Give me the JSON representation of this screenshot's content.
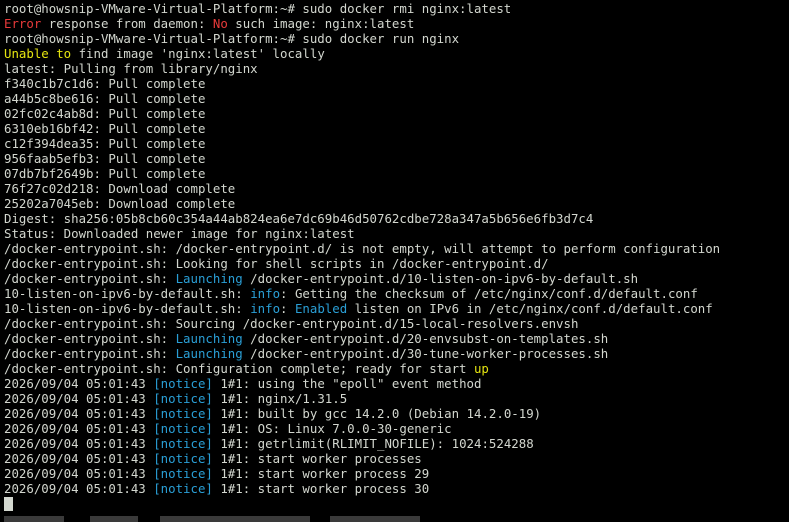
{
  "colors": {
    "background": "#000000",
    "foreground": "#d3d7cf",
    "red": "#e83a3a",
    "yellow": "#e5e510",
    "cyan": "#2a9fd6",
    "green": "#4ec94e"
  },
  "lines": [
    [
      {
        "t": "root@howsnip-VMware-Virtual-Platform:~# sudo docker rmi nginx:latest"
      }
    ],
    [
      {
        "t": "Error",
        "c": "red"
      },
      {
        "t": " response from daemon: "
      },
      {
        "t": "No",
        "c": "red"
      },
      {
        "t": " such image: nginx:latest"
      }
    ],
    [
      {
        "t": "root@howsnip-VMware-Virtual-Platform:~# sudo docker run nginx"
      }
    ],
    [
      {
        "t": "Unable to",
        "c": "yellow"
      },
      {
        "t": " find image 'nginx:latest' locally"
      }
    ],
    [
      {
        "t": "latest: Pulling from library/nginx"
      }
    ],
    [
      {
        "t": "f340c1b7c1d6: Pull complete"
      }
    ],
    [
      {
        "t": "a44b5c8be616: Pull complete"
      }
    ],
    [
      {
        "t": "02fc02c4ab8d: Pull complete"
      }
    ],
    [
      {
        "t": "6310eb16bf42: Pull complete"
      }
    ],
    [
      {
        "t": "c12f394dea35: Pull complete"
      }
    ],
    [
      {
        "t": "956faab5efb3: Pull complete"
      }
    ],
    [
      {
        "t": "07db7bf2649b: Pull complete"
      }
    ],
    [
      {
        "t": "76f27c02d218: Download complete"
      }
    ],
    [
      {
        "t": "25202a7045eb: Download complete"
      }
    ],
    [
      {
        "t": "Digest: sha256:05b8cb60c354a44ab824ea6e7dc69b46d50762cdbe728a347a5b656e6fb3d7c4"
      }
    ],
    [
      {
        "t": "Status: Downloaded newer image for nginx:latest"
      }
    ],
    [
      {
        "t": "/docker-entrypoint.sh: /docker-entrypoint.d/ is not empty, will attempt to perform configuration"
      }
    ],
    [
      {
        "t": "/docker-entrypoint.sh: Looking for shell scripts in /docker-entrypoint.d/"
      }
    ],
    [
      {
        "t": "/docker-entrypoint.sh: "
      },
      {
        "t": "Launching",
        "c": "cyan"
      },
      {
        "t": " /docker-entrypoint.d/10-listen-on-ipv6-by-default.sh"
      }
    ],
    [
      {
        "t": "10-listen-on-ipv6-by-default.sh: "
      },
      {
        "t": "info",
        "c": "cyan"
      },
      {
        "t": ": Getting the checksum of /etc/nginx/conf.d/default.conf"
      }
    ],
    [
      {
        "t": "10-listen-on-ipv6-by-default.sh: "
      },
      {
        "t": "info",
        "c": "cyan"
      },
      {
        "t": ": "
      },
      {
        "t": "Enabled",
        "c": "cyan"
      },
      {
        "t": " listen on IPv6 in /etc/nginx/conf.d/default.conf"
      }
    ],
    [
      {
        "t": "/docker-entrypoint.sh: Sourcing /docker-entrypoint.d/15-local-resolvers.envsh"
      }
    ],
    [
      {
        "t": "/docker-entrypoint.sh: "
      },
      {
        "t": "Launching",
        "c": "cyan"
      },
      {
        "t": " /docker-entrypoint.d/20-envsubst-on-templates.sh"
      }
    ],
    [
      {
        "t": "/docker-entrypoint.sh: "
      },
      {
        "t": "Launching",
        "c": "cyan"
      },
      {
        "t": " /docker-entrypoint.d/30-tune-worker-processes.sh"
      }
    ],
    [
      {
        "t": "/docker-entrypoint.sh: Configuration complete; ready for start "
      },
      {
        "t": "up",
        "c": "yellow"
      }
    ],
    [
      {
        "t": "2026/09/04 05:01:43 "
      },
      {
        "t": "[notice]",
        "c": "cyan"
      },
      {
        "t": " 1#1: using the \"epoll\" event method"
      }
    ],
    [
      {
        "t": "2026/09/04 05:01:43 "
      },
      {
        "t": "[notice]",
        "c": "cyan"
      },
      {
        "t": " 1#1: nginx/1.31.5"
      }
    ],
    [
      {
        "t": "2026/09/04 05:01:43 "
      },
      {
        "t": "[notice]",
        "c": "cyan"
      },
      {
        "t": " 1#1: built by gcc 14.2.0 (Debian 14.2.0-19)"
      }
    ],
    [
      {
        "t": "2026/09/04 05:01:43 "
      },
      {
        "t": "[notice]",
        "c": "cyan"
      },
      {
        "t": " 1#1: OS: Linux 7.0.0-30-generic"
      }
    ],
    [
      {
        "t": "2026/09/04 05:01:43 "
      },
      {
        "t": "[notice]",
        "c": "cyan"
      },
      {
        "t": " 1#1: getrlimit(RLIMIT_NOFILE): 1024:524288"
      }
    ],
    [
      {
        "t": "2026/09/04 05:01:43 "
      },
      {
        "t": "[notice]",
        "c": "cyan"
      },
      {
        "t": " 1#1: start worker processes"
      }
    ],
    [
      {
        "t": "2026/09/04 05:01:43 "
      },
      {
        "t": "[notice]",
        "c": "cyan"
      },
      {
        "t": " 1#1: start worker process 29"
      }
    ],
    [
      {
        "t": "2026/09/04 05:01:43 "
      },
      {
        "t": "[notice]",
        "c": "cyan"
      },
      {
        "t": " 1#1: start worker process 30"
      }
    ]
  ]
}
